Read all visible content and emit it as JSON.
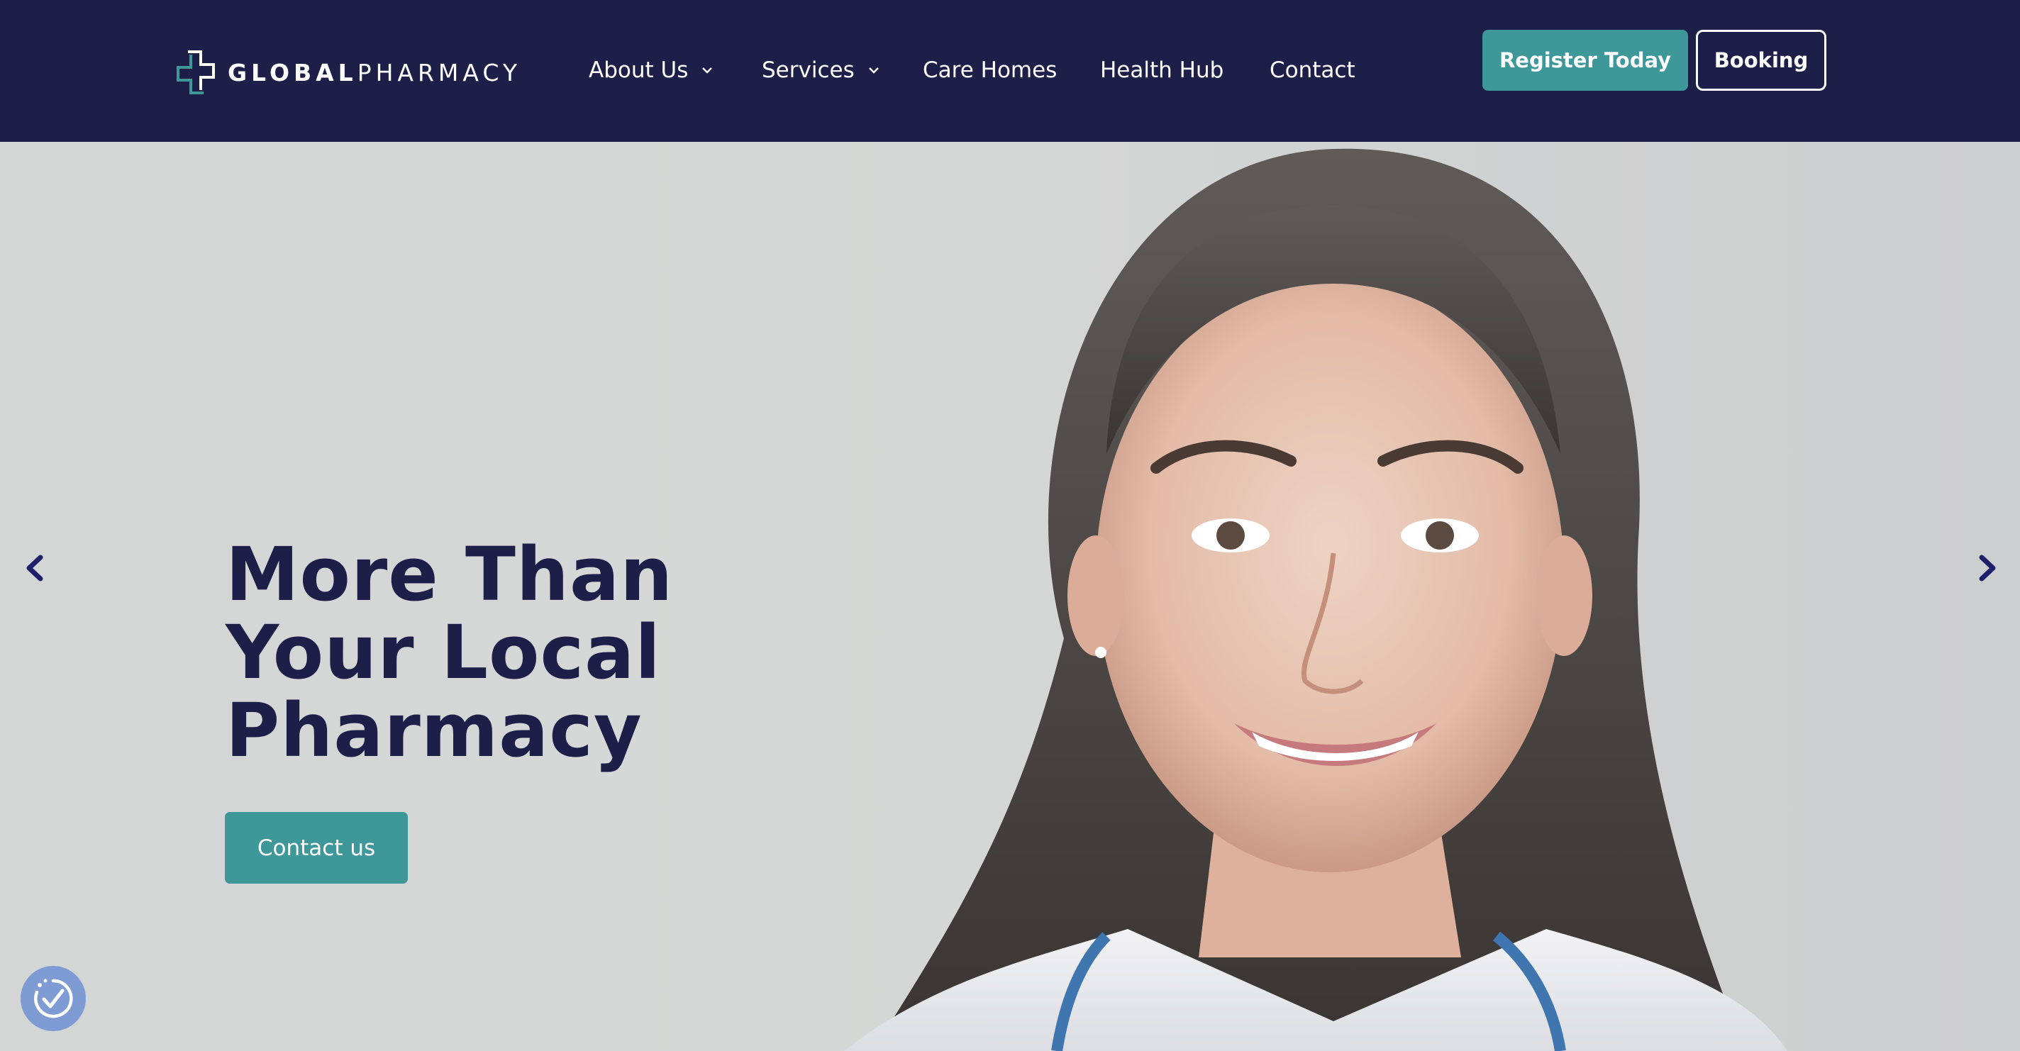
{
  "header": {
    "logo": {
      "bold": "GLOBAL",
      "light": "PHARMACY",
      "icon": "medical-cross-icon"
    },
    "nav": [
      {
        "label": "About Us",
        "dropdown": true
      },
      {
        "label": "Services",
        "dropdown": true
      },
      {
        "label": "Care Homes",
        "dropdown": false
      },
      {
        "label": "Health Hub",
        "dropdown": false
      },
      {
        "label": "Contact",
        "dropdown": false
      }
    ],
    "register_label": "Register Today",
    "booking_label": "Booking"
  },
  "hero": {
    "title_lines": [
      "More Than",
      "Your Local",
      "Pharmacy"
    ],
    "cta_label": "Contact us",
    "prev_icon": "chevron-left-icon",
    "next_icon": "chevron-right-icon",
    "image": "smiling-pharmacist-photo"
  },
  "accessibility_widget": {
    "icon": "accessibility-check-icon"
  },
  "colors": {
    "navy": "#1e1f49",
    "teal": "#3e9799",
    "hero_bg": "#d4d6d5",
    "widget": "#7e9bd4"
  }
}
